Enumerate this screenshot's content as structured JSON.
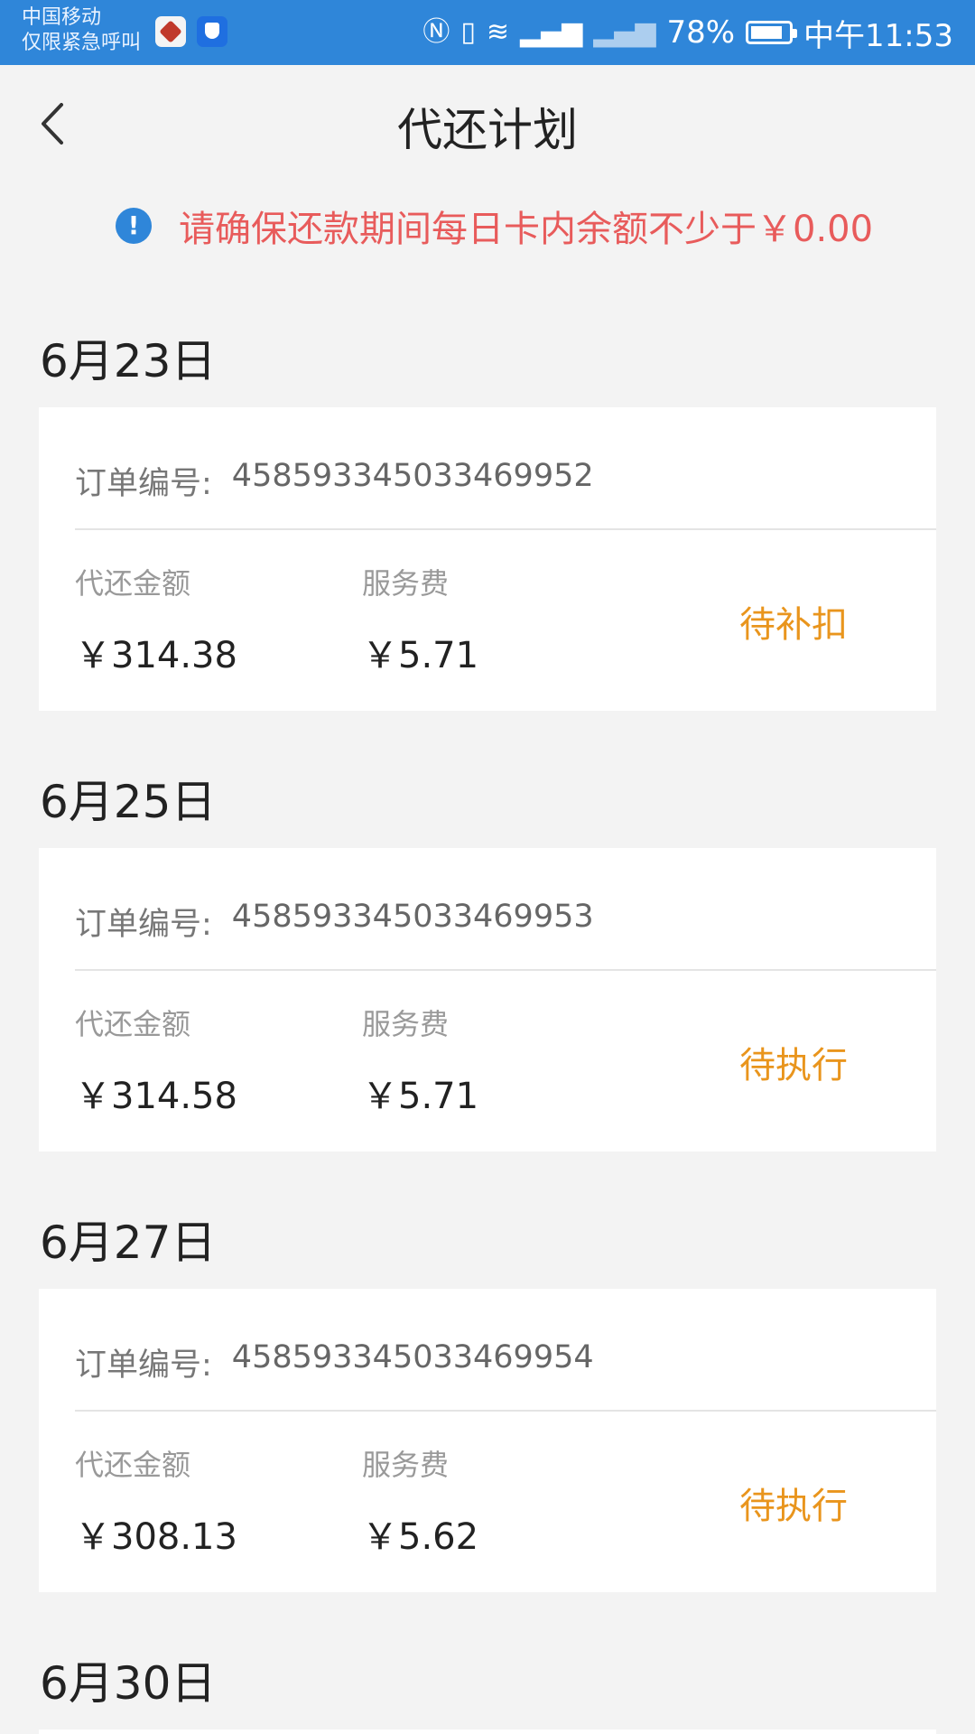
{
  "status_bar": {
    "carrier_line1": "中国移动",
    "carrier_line2": "仅限紧急呼叫",
    "battery": "78%",
    "time": "中午11:53"
  },
  "header": {
    "title": "代还计划",
    "back_icon": "chevron-left-icon"
  },
  "notice": {
    "icon": "exclamation-circle-icon",
    "text": "请确保还款期间每日卡内余额不少于￥0.00",
    "color": "#e85b5b"
  },
  "labels": {
    "order_label": "订单编号:",
    "amount_label": "代还金额",
    "fee_label": "服务费"
  },
  "plans": [
    {
      "date": "6月23日",
      "order_no": "458593345033469952",
      "amount": "￥314.38",
      "fee": "￥5.71",
      "status": "待补扣"
    },
    {
      "date": "6月25日",
      "order_no": "458593345033469953",
      "amount": "￥314.58",
      "fee": "￥5.71",
      "status": "待执行"
    },
    {
      "date": "6月27日",
      "order_no": "458593345033469954",
      "amount": "￥308.13",
      "fee": "￥5.62",
      "status": "待执行"
    },
    {
      "date": "6月30日"
    }
  ],
  "colors": {
    "accent": "#2f86d9",
    "status": "#e9951d"
  }
}
